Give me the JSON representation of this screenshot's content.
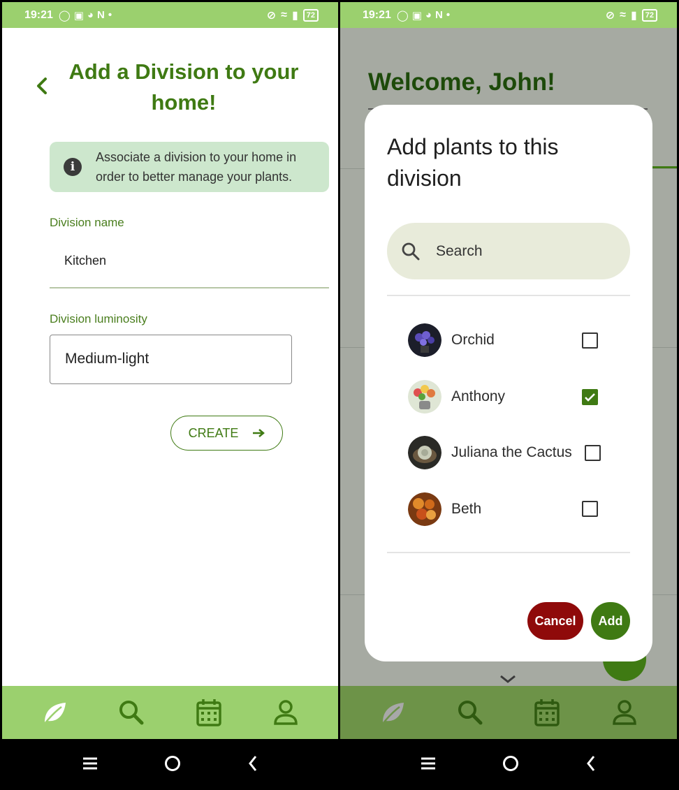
{
  "status_bar": {
    "time": "19:21",
    "battery": "72",
    "left_icons": [
      "whatsapp-icon",
      "instagram-icon",
      "food-icon",
      "netflix-icon"
    ],
    "netflix_letter": "N",
    "dot": "•"
  },
  "left_screen": {
    "title": "Add a Division to your home!",
    "info_text": "Associate a division to your home in order to better manage your plants.",
    "info_icon_glyph": "i",
    "division_name_label": "Division name",
    "division_name_value": "Kitchen",
    "luminosity_label": "Division luminosity",
    "luminosity_value": "Medium-light",
    "create_button": "CREATE"
  },
  "right_screen": {
    "welcome": "Welcome, John!",
    "dialog": {
      "title": "Add plants to this division",
      "search_placeholder": "Search",
      "plants": [
        {
          "name": "Orchid",
          "checked": false
        },
        {
          "name": "Anthony",
          "checked": true
        },
        {
          "name": "Juliana the Cactus",
          "checked": false
        },
        {
          "name": "Beth",
          "checked": false
        }
      ],
      "cancel_button": "Cancel",
      "add_button": "Add"
    }
  },
  "bottom_nav": {
    "items": [
      "leaf-icon",
      "search-icon",
      "calendar-icon",
      "profile-icon"
    ]
  },
  "colors": {
    "primary_green": "#3f7a13",
    "light_green": "#9bd06e",
    "info_bg": "#cde7cd",
    "cancel_red": "#8f0a0a"
  }
}
